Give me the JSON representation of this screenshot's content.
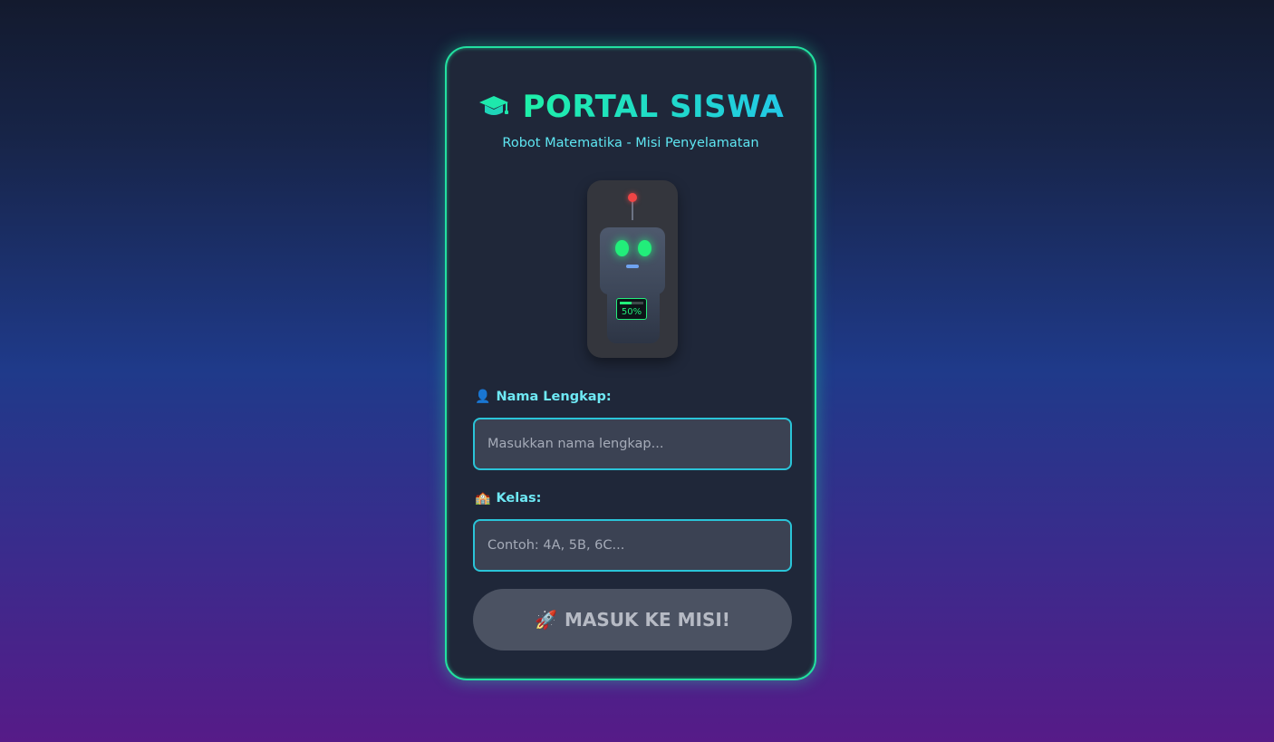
{
  "header": {
    "icon": "graduation-cap-icon",
    "title": "PORTAL SISWA",
    "subtitle": "Robot Matematika - Misi Penyelamatan"
  },
  "robot": {
    "battery_label": "50%",
    "battery_level": 0.5,
    "eye_color": "#22ee7a",
    "antenna_color": "#f04545"
  },
  "form": {
    "name": {
      "icon": "person-icon",
      "icon_glyph": "👤",
      "label": "Nama Lengkap:",
      "value": "",
      "placeholder": "Masukkan nama lengkap..."
    },
    "class": {
      "icon": "school-icon",
      "icon_glyph": "🏫",
      "label": "Kelas:",
      "value": "",
      "placeholder": "Contoh: 4A, 5B, 6C..."
    },
    "submit": {
      "icon": "rocket-icon",
      "icon_glyph": "🚀",
      "label": "MASUK KE MISI!"
    }
  },
  "colors": {
    "accent_green": "#22e0a0",
    "accent_cyan": "#2ac4d8",
    "card_bg": "#1f2739",
    "button_disabled": "#4b5262"
  }
}
